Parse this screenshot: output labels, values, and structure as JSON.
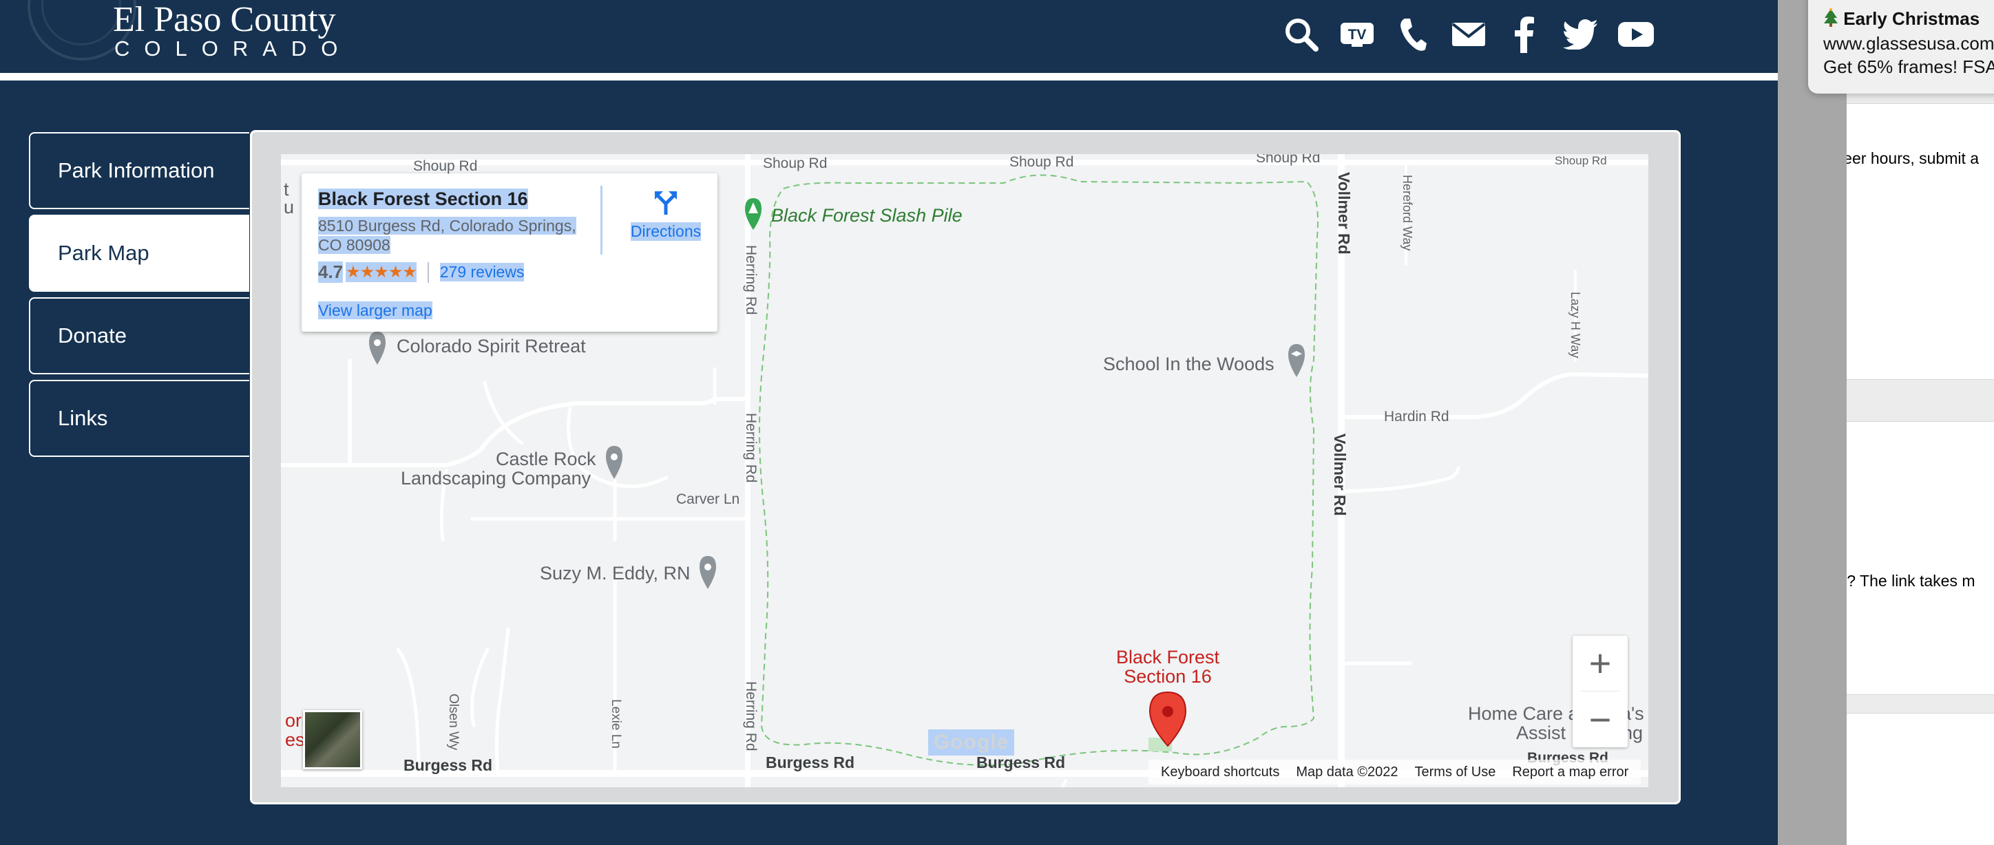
{
  "header": {
    "logo_title": "El Paso County",
    "logo_subtitle": "COLORADO",
    "icons": [
      "search-icon",
      "tv-icon",
      "phone-icon",
      "mail-icon",
      "facebook-icon",
      "twitter-icon",
      "youtube-icon"
    ]
  },
  "nav": {
    "items": [
      {
        "label": "Park Information",
        "active": false
      },
      {
        "label": "Park Map",
        "active": true
      },
      {
        "label": "Donate",
        "active": false
      },
      {
        "label": "Links",
        "active": false
      }
    ]
  },
  "map": {
    "place_card": {
      "title": "Black Forest Section 16",
      "address": "8510 Burgess Rd, Colorado Springs, CO 80908",
      "rating": "4.7",
      "stars": "★★★★★",
      "reviews": "279 reviews",
      "larger_map": "View larger map",
      "directions": "Directions"
    },
    "pois": {
      "slash_pile": "Black Forest Slash Pile",
      "spirit_retreat": "Colorado Spirit Retreat",
      "school": "School In the Woods",
      "castle_rock_1": "Castle Rock",
      "castle_rock_2": "Landscaping Company",
      "suzy": "Suzy M. Eddy, RN",
      "marker_1": "Black Forest",
      "marker_2": "Section 16",
      "home_care_1": "Home Care a",
      "home_care_2": "a's",
      "home_care_3": "Assist",
      "home_care_4": "ng",
      "left_cut_1": "or",
      "left_cut_2": "es",
      "top_left_cut_1": "t",
      "top_left_cut_2": "u"
    },
    "streets": {
      "shoup_1": "Shoup Rd",
      "shoup_2": "Shoup Rd",
      "shoup_3": "Shoup Rd",
      "shoup_4": "Shoup Rd",
      "shoup_5": "Shoup Rd",
      "vollmer_1": "Vollmer Rd",
      "vollmer_2": "Vollmer Rd",
      "hereford": "Hereford Way",
      "lazy_h": "Lazy H Way",
      "hardin": "Hardin Rd",
      "herring_1": "Herring Rd",
      "herring_2": "Herring Rd",
      "herring_3": "Herring Rd",
      "carver": "Carver Ln",
      "olsen": "Olsen Wy",
      "lexie": "Lexie Ln",
      "burgess_1": "Burgess Rd",
      "burgess_2": "Burgess Rd",
      "burgess_3": "Burgess Rd",
      "burgess_4": "Burgess Rd"
    },
    "google_logo": "Google",
    "footer": {
      "shortcuts": "Keyboard shortcuts",
      "data": "Map data ©2022",
      "terms": "Terms of Use",
      "report": "Report a map error"
    },
    "zoom_in": "+",
    "zoom_out": "−"
  },
  "notification": {
    "title": "Early Christmas",
    "url": "www.glassesusa.com",
    "text": "Get 65% frames! FSA"
  },
  "right_panel": {
    "text1": "nteer hours, submit a",
    "text2": "se? The link takes m"
  }
}
